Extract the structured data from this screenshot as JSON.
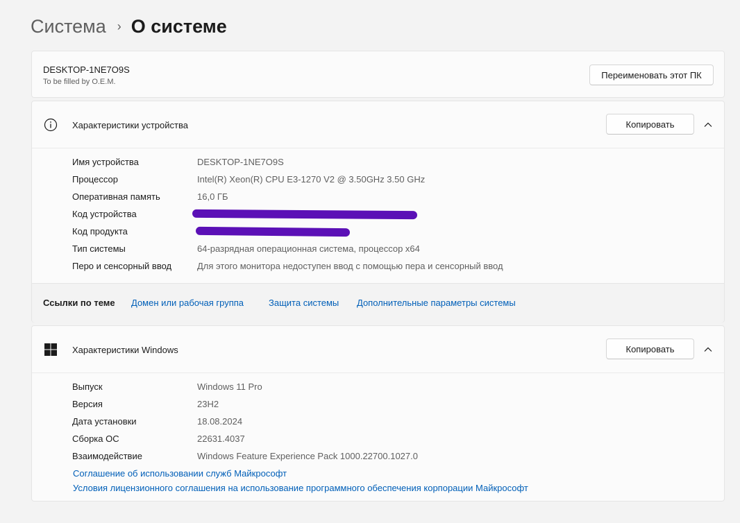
{
  "breadcrumb": {
    "parent": "Система",
    "separator": "›",
    "current": "О системе"
  },
  "pc": {
    "name": "DESKTOP-1NE7O9S",
    "subtitle": "To be filled by O.E.M.",
    "rename_label": "Переименовать этот ПК"
  },
  "device_specs": {
    "title": "Характеристики устройства",
    "copy_label": "Копировать",
    "icon": "info-icon",
    "rows": [
      {
        "label": "Имя устройства",
        "value": "DESKTOP-1NE7O9S"
      },
      {
        "label": "Процессор",
        "value": "Intel(R) Xeon(R) CPU E3-1270 V2 @ 3.50GHz   3.50 GHz"
      },
      {
        "label": "Оперативная память",
        "value": "16,0 ГБ"
      },
      {
        "label": "Код устройства",
        "value": ""
      },
      {
        "label": "Код продукта",
        "value": ""
      },
      {
        "label": "Тип системы",
        "value": "64-разрядная операционная система, процессор x64"
      },
      {
        "label": "Перо и сенсорный ввод",
        "value": "Для этого монитора недоступен ввод с помощью пера и сенсорный ввод"
      }
    ]
  },
  "related": {
    "label": "Ссылки по теме",
    "links": [
      "Домен или рабочая группа",
      "Защита системы",
      "Дополнительные параметры системы"
    ]
  },
  "windows_specs": {
    "title": "Характеристики Windows",
    "copy_label": "Копировать",
    "icon": "windows-logo-icon",
    "rows": [
      {
        "label": "Выпуск",
        "value": "Windows 11 Pro"
      },
      {
        "label": "Версия",
        "value": "23H2"
      },
      {
        "label": "Дата установки",
        "value": "18.08.2024"
      },
      {
        "label": "Сборка ОС",
        "value": "22631.4037"
      },
      {
        "label": "Взаимодействие",
        "value": "Windows Feature Experience Pack 1000.22700.1027.0"
      }
    ],
    "links": [
      "Соглашение об использовании служб Майкрософт",
      "Условия лицензионного соглашения на использование программного обеспечения корпорации Майкрософт"
    ]
  },
  "colors": {
    "link": "#005fb8",
    "scribble": "#5b10b6",
    "background": "#f3f3f3"
  }
}
